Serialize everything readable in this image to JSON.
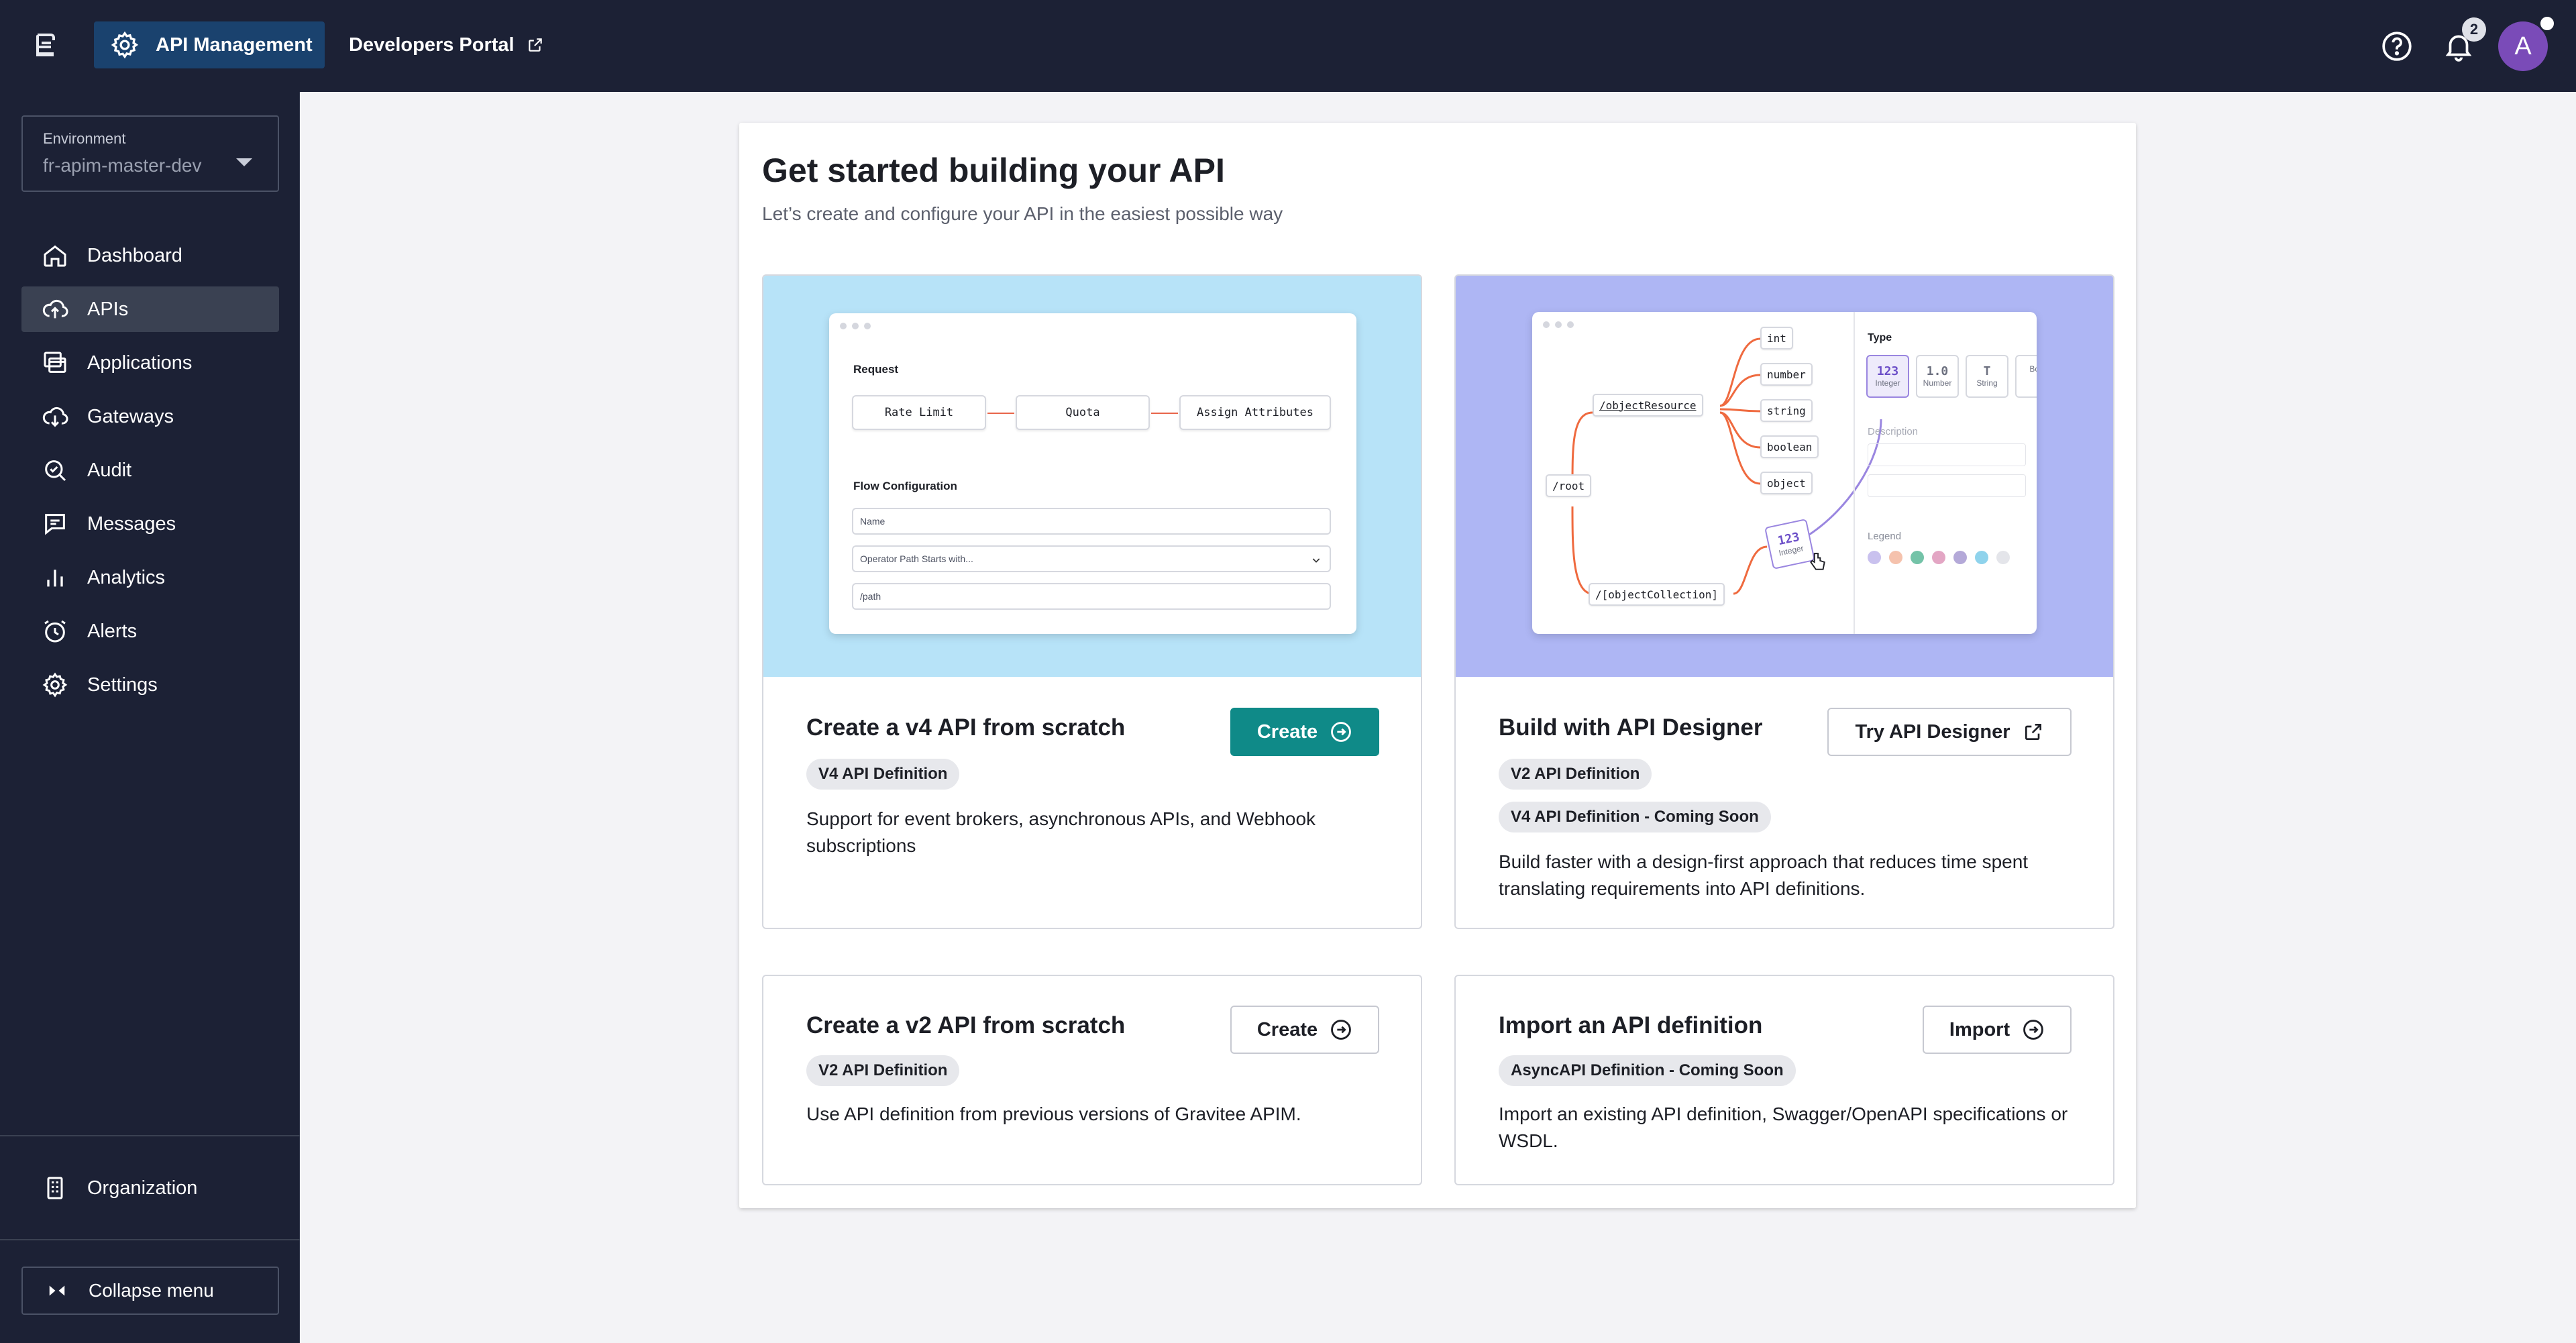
{
  "topbar": {
    "apim_label": "API Management",
    "portal_label": "Developers Portal",
    "notification_count": "2",
    "avatar_initial": "A"
  },
  "sidebar": {
    "env_label": "Environment",
    "env_value": "fr-apim-master-dev",
    "items": [
      {
        "label": "Dashboard",
        "icon": "home-icon"
      },
      {
        "label": "APIs",
        "icon": "cloud-upload-icon",
        "active": true
      },
      {
        "label": "Applications",
        "icon": "applications-icon"
      },
      {
        "label": "Gateways",
        "icon": "cloud-download-icon"
      },
      {
        "label": "Audit",
        "icon": "audit-search-icon"
      },
      {
        "label": "Messages",
        "icon": "message-icon"
      },
      {
        "label": "Analytics",
        "icon": "bar-chart-icon"
      },
      {
        "label": "Alerts",
        "icon": "alarm-clock-icon"
      },
      {
        "label": "Settings",
        "icon": "gear-icon"
      }
    ],
    "organization_label": "Organization",
    "collapse_label": "Collapse menu"
  },
  "main": {
    "title": "Get started building your API",
    "subtitle": "Let’s create and configure your API in the easiest possible way",
    "options": {
      "v4": {
        "title": "Create a v4 API from scratch",
        "chips": [
          "V4 API Definition"
        ],
        "description": "Support for event brokers, asynchronous APIs, and Webhook subscriptions",
        "button": "Create"
      },
      "designer": {
        "title": "Build with API Designer",
        "chips": [
          "V2 API Definition",
          "V4 API Definition - Coming Soon"
        ],
        "description": "Build faster with a design-first approach that reduces time spent translating requirements into API definitions.",
        "button": "Try API Designer"
      },
      "v2": {
        "title": "Create a v2 API from scratch",
        "chips": [
          "V2 API Definition"
        ],
        "description": "Use API definition from previous versions of Gravitee APIM.",
        "button": "Create"
      },
      "import": {
        "title": "Import an API definition",
        "chips": [
          "AsyncAPI Definition - Coming Soon"
        ],
        "description": "Import an existing API definition, Swagger/OpenAPI specifications or WSDL.",
        "button": "Import"
      }
    },
    "illustration_v4": {
      "request_label": "Request",
      "steps": [
        "Rate Limit",
        "Quota",
        "Assign Attributes"
      ],
      "flow_label": "Flow Configuration",
      "name_placeholder": "Name",
      "operator_placeholder": "Operator Path Starts with...",
      "path_placeholder": "/path"
    },
    "illustration_designer": {
      "nodes": [
        "int",
        "number",
        "string",
        "boolean",
        "object"
      ],
      "resource": "/objectResource",
      "root": "/root",
      "collection": "/[objectCollection]",
      "type_label": "Type",
      "types": [
        {
          "glyph": "123",
          "name": "Integer"
        },
        {
          "glyph": "1.0",
          "name": "Number"
        },
        {
          "glyph": "T",
          "name": "String"
        },
        {
          "glyph": "",
          "name": "Boo"
        }
      ],
      "description_label": "Description",
      "legend_label": "Legend",
      "drag_glyph": "123",
      "drag_name": "Integer",
      "legend_colors": [
        "#c9c1ee",
        "#f5c2ad",
        "#74c3a8",
        "#e3a6c4",
        "#b4a9d8",
        "#8fd3ec",
        "#e4e5ea"
      ]
    }
  }
}
